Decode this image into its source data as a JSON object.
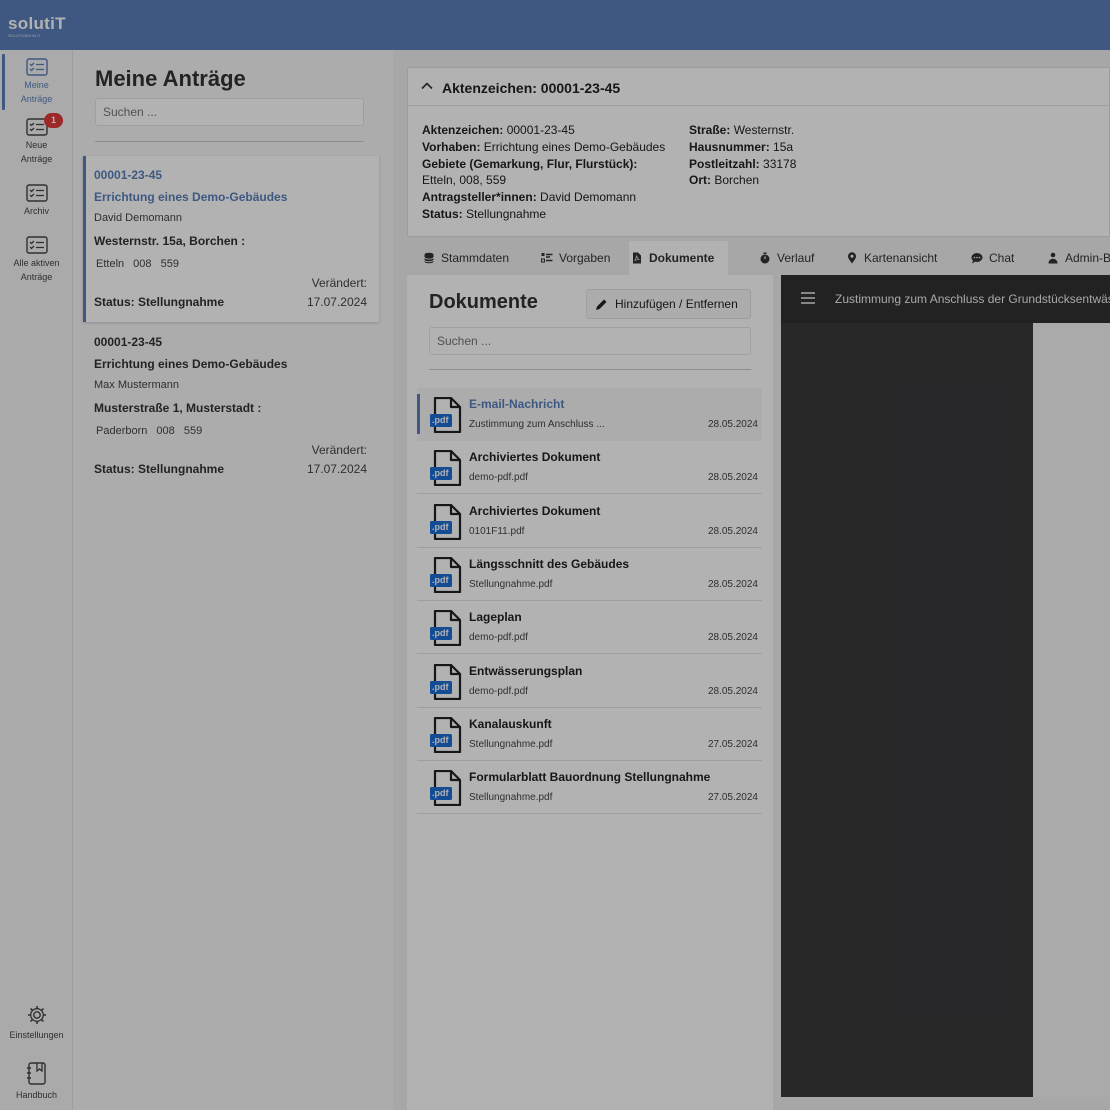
{
  "app": {
    "logo": "solutiT",
    "logo_tagline": "SOLUTIONS IN IT"
  },
  "nav": {
    "items": [
      {
        "label": "Meine Anträge",
        "line1": "Meine",
        "line2": "Anträge"
      },
      {
        "label": "Neue Anträge",
        "line1": "Neue",
        "line2": "Anträge",
        "badge": "1"
      },
      {
        "label": "Archiv",
        "line1": "Archiv",
        "line2": ""
      },
      {
        "label": "Alle aktiven Anträge",
        "line1": "Alle aktiven",
        "line2": "Anträge"
      }
    ],
    "settings": "Einstellungen",
    "manual": "Handbuch"
  },
  "list": {
    "title": "Meine Anträge",
    "search_placeholder": "Suchen ...",
    "cards": [
      {
        "number": "00001-23-45",
        "project": "Errichtung eines Demo-Gebäudes",
        "person": "David Demomann",
        "address": "Westernstr. 15a, Borchen :",
        "parcel": "Etteln 008 559",
        "changed_label": "Verändert:",
        "status": "Status: Stellungnahme",
        "date": "17.07.2024"
      },
      {
        "number": "00001-23-45",
        "project": "Errichtung eines Demo-Gebäudes",
        "person": "Max Mustermann",
        "address": "Musterstraße 1, Musterstadt :",
        "parcel": "Paderborn 008 559",
        "changed_label": "Verändert:",
        "status": "Status: Stellungnahme",
        "date": "17.07.2024"
      }
    ]
  },
  "detail": {
    "header_title": "Aktenzeichen: 00001-23-45",
    "left": [
      {
        "label": "Aktenzeichen:",
        "value": "00001-23-45"
      },
      {
        "label": "Vorhaben:",
        "value": "Errichtung eines Demo-Gebäudes"
      },
      {
        "label": "Gebiete (Gemarkung, Flur, Flurstück):",
        "value": ""
      },
      {
        "label": "",
        "value": "Etteln, 008, 559"
      },
      {
        "label": "Antragsteller*innen:",
        "value": "David Demomann"
      },
      {
        "label": "Status:",
        "value": "Stellungnahme"
      }
    ],
    "right": [
      {
        "label": "Straße:",
        "value": "Westernstr."
      },
      {
        "label": "Hausnummer:",
        "value": "15a"
      },
      {
        "label": "Postleitzahl:",
        "value": "33178"
      },
      {
        "label": "Ort:",
        "value": "Borchen"
      }
    ],
    "tabs": [
      "Stammdaten",
      "Vorgaben",
      "Dokumente",
      "Verlauf",
      "Kartenansicht",
      "Chat",
      "Admin-Bereich"
    ],
    "active_tab": "Dokumente"
  },
  "documents": {
    "title": "Dokumente",
    "add_button": "Hinzufügen / Entfernen",
    "search_placeholder": "Suchen ...",
    "pdf_label": ".pdf",
    "items": [
      {
        "name": "E-mail-Nachricht",
        "file": "Zustimmung zum Anschluss ...",
        "date": "28.05.2024"
      },
      {
        "name": "Archiviertes Dokument",
        "file": "demo-pdf.pdf",
        "date": "28.05.2024"
      },
      {
        "name": "Archiviertes Dokument",
        "file": "0101F11.pdf",
        "date": "28.05.2024"
      },
      {
        "name": "Längsschnitt des Gebäudes",
        "file": "Stellungnahme.pdf",
        "date": "28.05.2024"
      },
      {
        "name": "Lageplan",
        "file": "demo-pdf.pdf",
        "date": "28.05.2024"
      },
      {
        "name": "Entwässerungsplan",
        "file": "demo-pdf.pdf",
        "date": "28.05.2024"
      },
      {
        "name": "Kanalauskunft",
        "file": "Stellungnahme.pdf",
        "date": "27.05.2024"
      },
      {
        "name": "Formularblatt Bauordnung Stellungnahme",
        "file": "Stellungnahme.pdf",
        "date": "27.05.2024"
      }
    ]
  },
  "viewer": {
    "title": "Zustimmung zum Anschluss der Grundstücksentwässerung"
  },
  "colors": {
    "brand": "#5a7fb9",
    "badge": "#e03a3a",
    "viewer_dark": "#323233"
  }
}
